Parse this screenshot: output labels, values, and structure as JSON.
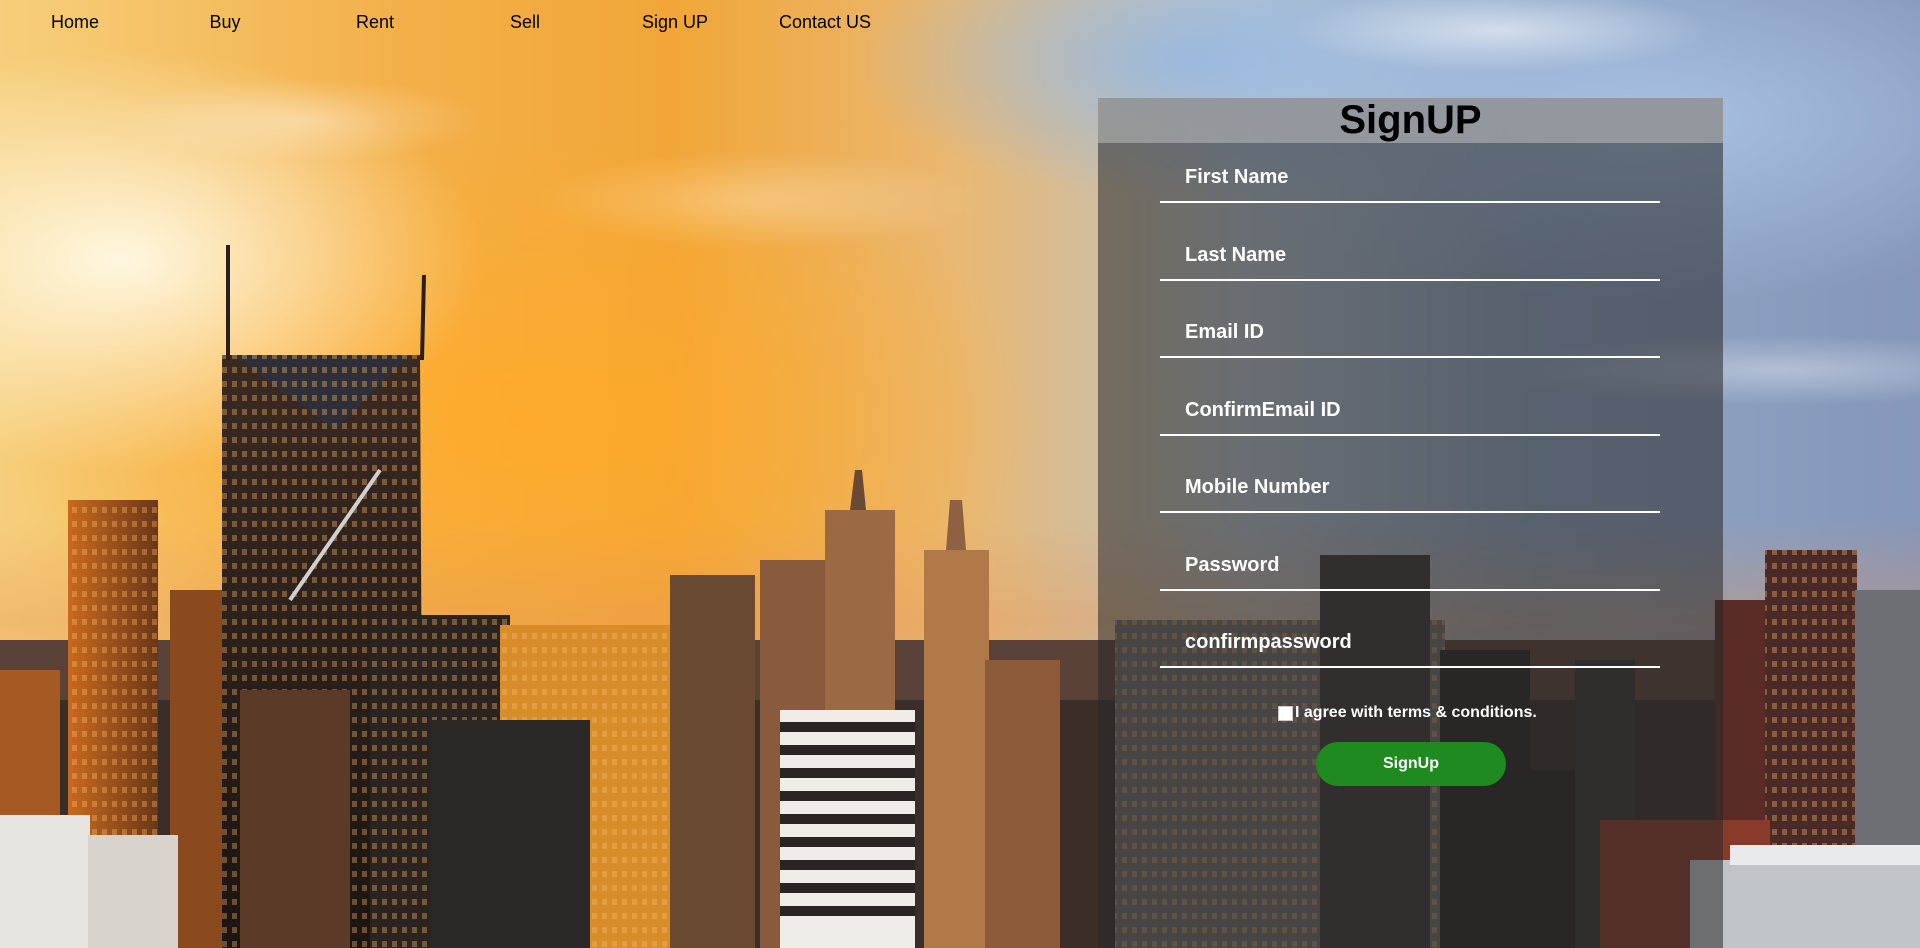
{
  "nav": {
    "items": [
      "Home",
      "Buy",
      "Rent",
      "Sell",
      "Sign UP",
      "Contact US"
    ]
  },
  "signup": {
    "title": "SignUP",
    "fields": {
      "first_name": "First Name",
      "last_name": "Last Name",
      "email": "Email ID",
      "confirm_email": "ConfirmEmail ID",
      "mobile": "Mobile Number",
      "password": "Password",
      "confirm_password": "confirmpassword"
    },
    "terms_label": "I agree with terms & conditions.",
    "terms_checked": false,
    "button_label": "SignUp"
  },
  "colors": {
    "button": "#1f8a1f",
    "panel_overlay": "rgba(40,40,40,0.55)",
    "panel_header": "rgba(190,190,190,0.55)"
  },
  "background": {
    "description_icon": "city-skyline-sunset-image"
  }
}
